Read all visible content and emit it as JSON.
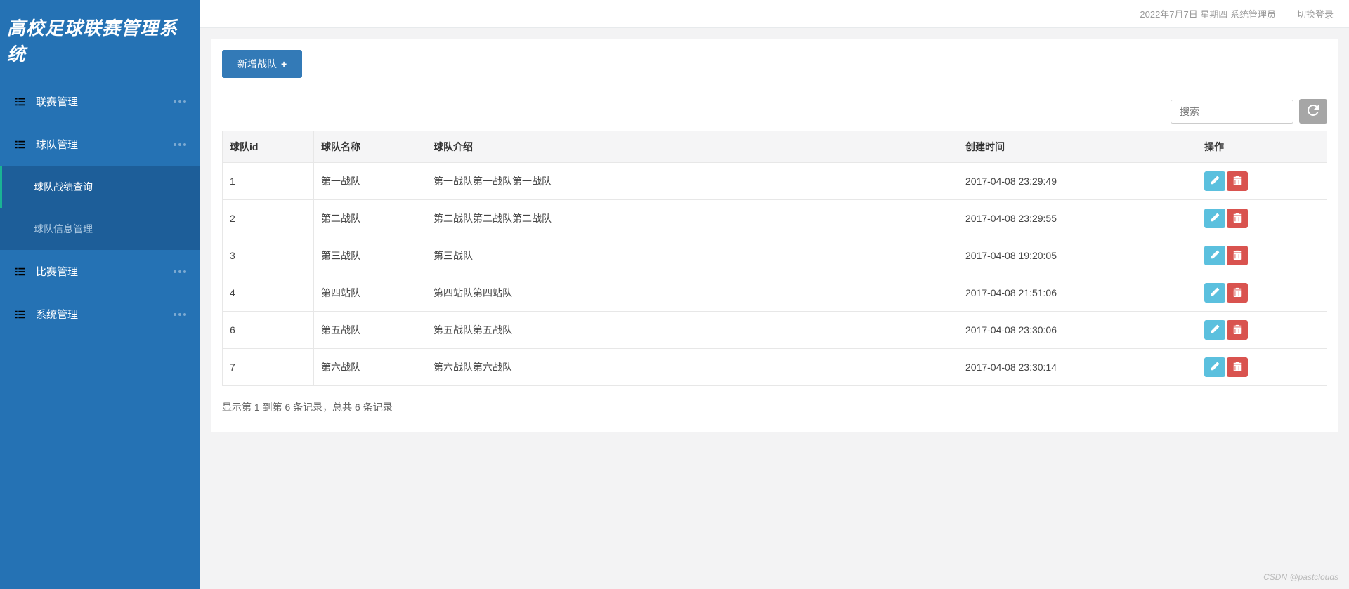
{
  "app": {
    "title": "高校足球联赛管理系统"
  },
  "topbar": {
    "date_info": "2022年7月7日 星期四 系统管理员",
    "switch_login": "切换登录"
  },
  "sidebar": {
    "items": [
      {
        "label": "联赛管理"
      },
      {
        "label": "球队管理"
      },
      {
        "label": "比赛管理"
      },
      {
        "label": "系统管理"
      }
    ],
    "sub_items": [
      {
        "label": "球队战绩查询"
      },
      {
        "label": "球队信息管理"
      }
    ]
  },
  "actions": {
    "add_team": "新增战队"
  },
  "search": {
    "placeholder": "搜索"
  },
  "table": {
    "headers": {
      "id": "球队id",
      "name": "球队名称",
      "intro": "球队介绍",
      "created": "创建时间",
      "ops": "操作"
    },
    "rows": [
      {
        "id": "1",
        "name": "第一战队",
        "intro": "第一战队第一战队第一战队",
        "created": "2017-04-08 23:29:49"
      },
      {
        "id": "2",
        "name": "第二战队",
        "intro": "第二战队第二战队第二战队",
        "created": "2017-04-08 23:29:55"
      },
      {
        "id": "3",
        "name": "第三战队",
        "intro": "第三战队",
        "created": "2017-04-08 19:20:05"
      },
      {
        "id": "4",
        "name": "第四站队",
        "intro": "第四站队第四站队",
        "created": "2017-04-08 21:51:06"
      },
      {
        "id": "6",
        "name": "第五战队",
        "intro": "第五战队第五战队",
        "created": "2017-04-08 23:30:06"
      },
      {
        "id": "7",
        "name": "第六战队",
        "intro": "第六战队第六战队",
        "created": "2017-04-08 23:30:14"
      }
    ]
  },
  "pagination": {
    "info": "显示第 1 到第 6 条记录，总共 6 条记录"
  },
  "watermark": "CSDN @pastclouds"
}
